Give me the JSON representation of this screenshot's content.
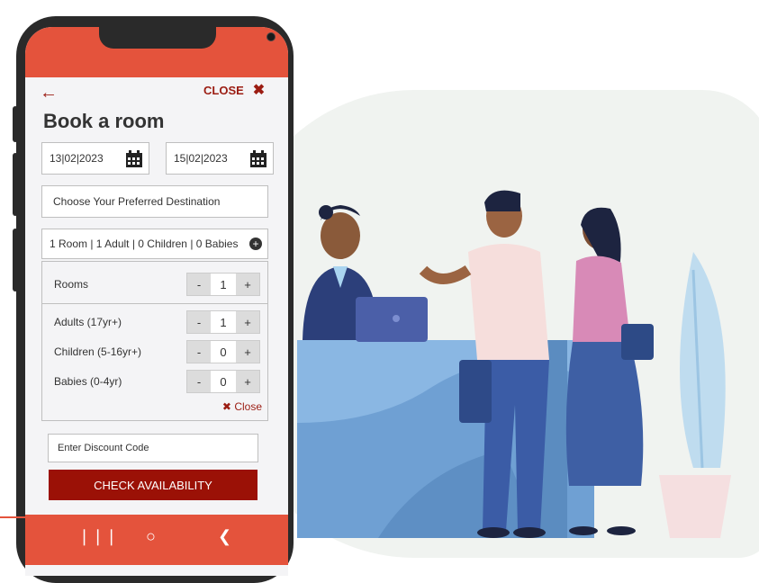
{
  "header": {
    "close_label": "CLOSE"
  },
  "form": {
    "title": "Book a room",
    "checkin": "13|02|2023",
    "checkout": "15|02|2023",
    "destination_placeholder": "Choose Your Preferred Destination",
    "guests_summary": "1 Room | 1 Adult | 0 Children | 0 Babies",
    "rooms": {
      "label": "Rooms",
      "value": "1"
    },
    "adults": {
      "label": "Adults (17yr+)",
      "value": "1"
    },
    "children": {
      "label": "Children (5-16yr+)",
      "value": "0"
    },
    "babies": {
      "label": "Babies (0-4yr)",
      "value": "0"
    },
    "minus": "-",
    "plus": "+",
    "panel_close": "Close",
    "discount_placeholder": "Enter Discount Code",
    "check_label": "CHECK AVAILABILITY"
  },
  "colors": {
    "brand": "#e4533c",
    "accent": "#9b1106",
    "desk": "#6fa0d3"
  }
}
